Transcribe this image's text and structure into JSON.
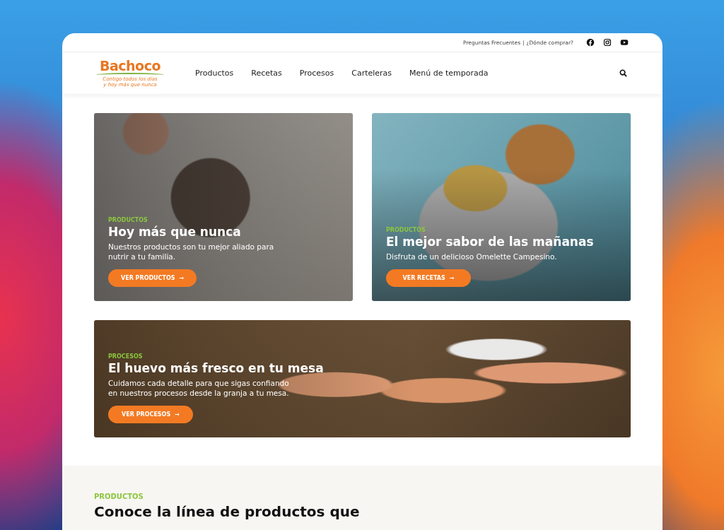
{
  "top_bar": {
    "links": [
      "Preguntas Frecuentes",
      "|",
      "¿Dónde comprar?"
    ],
    "social": [
      {
        "kind": "facebook"
      },
      {
        "kind": "instagram"
      },
      {
        "kind": "youtube"
      }
    ]
  },
  "header": {
    "logo": {
      "name": "Bachoco",
      "tagline": [
        "Contigo todos los días",
        "y hoy más que nunca"
      ]
    },
    "nav": [
      "Productos",
      "Recetas",
      "Procesos",
      "Carteleras",
      "Menú de temporada"
    ]
  },
  "cards": [
    {
      "kind": "food",
      "eyebrow": "PRODUCTOS",
      "title": "Hoy más que nunca",
      "text": "Nuestros productos son tu mejor aliado para nutrir a tu familia.",
      "button": "VER PRODUCTOS",
      "arrow": "→"
    },
    {
      "kind": "breakfast",
      "eyebrow": "PRODUCTOS",
      "title": "El mejor sabor de las mañanas",
      "text": "Disfruta de un delicioso Omelette Campesino.",
      "button": "VER RECETAS",
      "arrow": "→"
    },
    {
      "kind": "eggs",
      "eyebrow": "PROCESOS",
      "title": "El huevo más fresco en tu mesa",
      "text": "Cuidamos cada detalle para que sigas confiando en nuestros procesos desde la granja a tu mesa.",
      "button": "VER PROCESOS",
      "arrow": "→"
    }
  ],
  "products_section": {
    "eyebrow": "PRODUCTOS",
    "title": "Conoce la línea de productos que"
  }
}
